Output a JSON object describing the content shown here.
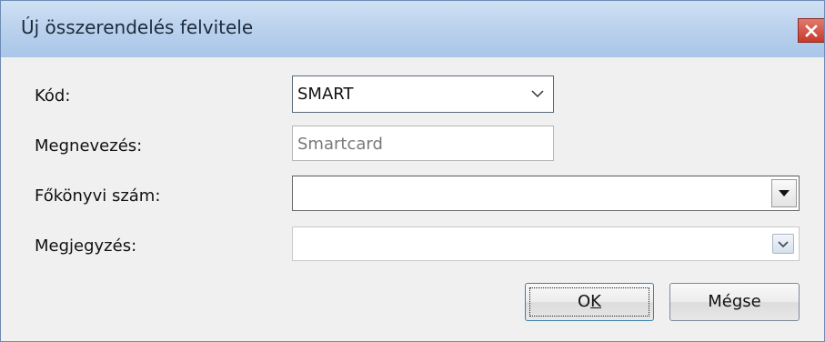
{
  "window": {
    "title": "Új összerendelés felvitele"
  },
  "form": {
    "kod": {
      "label": "Kód:",
      "value": "SMART"
    },
    "megnevezes": {
      "label": "Megnevezés:",
      "value": "Smartcard"
    },
    "fokonyvi_szam": {
      "label": "Főkönyvi szám:",
      "value": ""
    },
    "megjegyzes": {
      "label": "Megjegyzés:",
      "value": ""
    }
  },
  "buttons": {
    "ok": {
      "label_prefix": "O",
      "label_underlined": "K"
    },
    "cancel": {
      "label": "Mégse"
    }
  },
  "icons": {
    "close": "close-icon",
    "chevron": "chevron-down-icon",
    "dropdown": "dropdown-arrow-icon"
  },
  "colors": {
    "titlebar": "#bcd3ee",
    "close_button": "#c8392b"
  }
}
